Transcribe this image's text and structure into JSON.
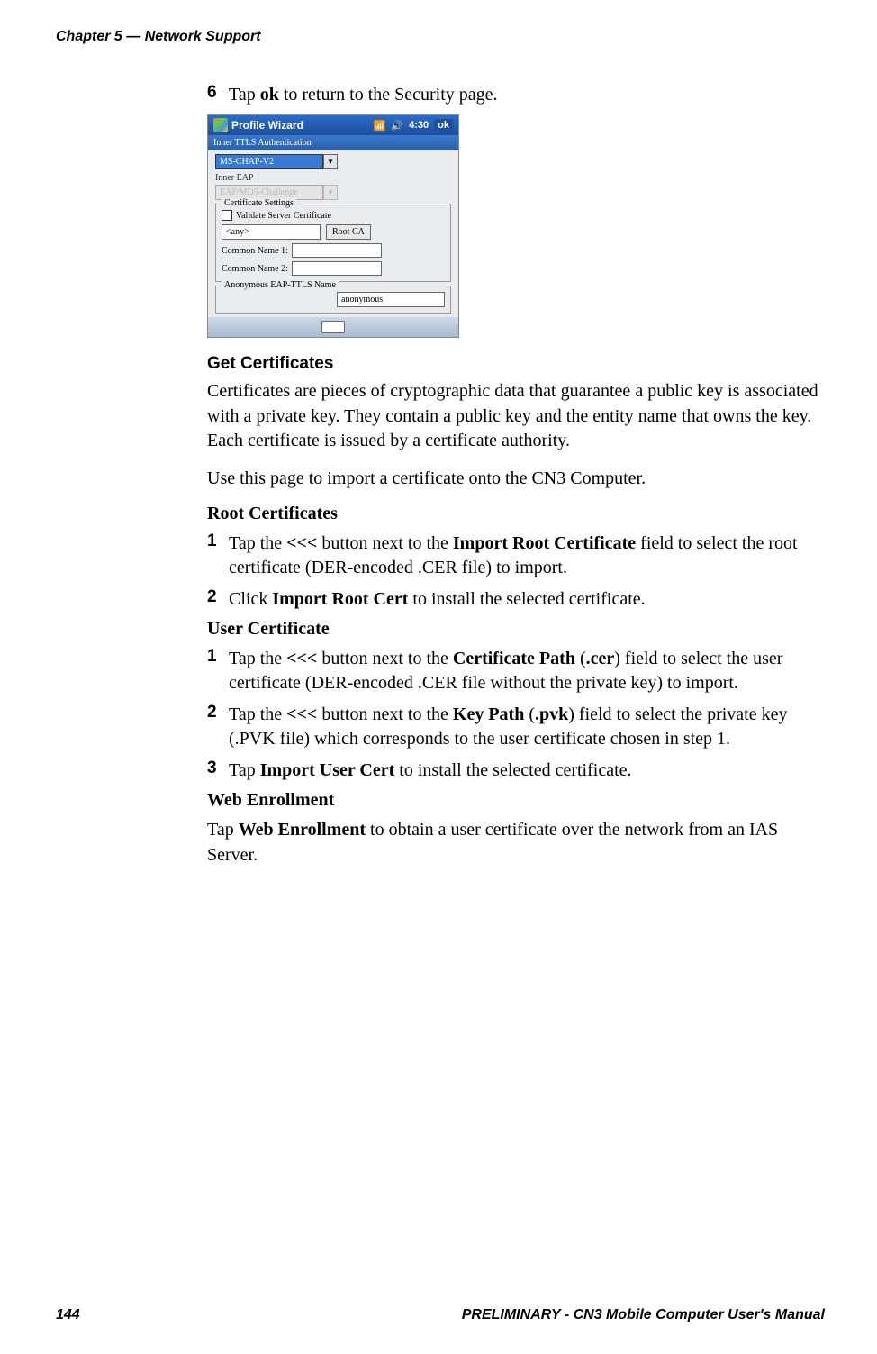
{
  "header": "Chapter 5 — Network Support",
  "step6": {
    "num": "6",
    "text_a": "Tap ",
    "text_b": "ok",
    "text_c": " to return to the Security page."
  },
  "screenshot": {
    "title": "Profile Wizard",
    "time": "4:30",
    "ok": "ok",
    "inner_ttls": "Inner TTLS Authentication",
    "ms_chap": "MS-CHAP-V2",
    "inner_eap": "Inner EAP",
    "eap_md5": "EAP/MD5-Challenge",
    "cert_settings": "Certificate Settings",
    "validate": "Validate Server Certificate",
    "any": "<any>",
    "root_ca": "Root CA",
    "cn1": "Common Name 1:",
    "cn2": "Common Name 2:",
    "anon_legend": "Anonymous EAP-TTLS Name",
    "anon_val": "anonymous"
  },
  "get_cert_head": "Get Certificates",
  "para1": "Certificates are pieces of cryptographic data that guarantee a public key is associated with a private key. They contain a public key and the entity name that owns the key. Each certificate is issued by a certificate authority.",
  "para2": "Use this page to import a certificate onto the CN3 Computer.",
  "root_cert_head": "Root Certificates",
  "rc1": {
    "num": "1",
    "a": "Tap the ",
    "b": "<<<",
    "c": " button next to the ",
    "d": "Import Root Certificate",
    "e": " field to select the root certificate (DER-encoded .CER file) to import."
  },
  "rc2": {
    "num": "2",
    "a": "Click ",
    "b": "Import Root Cert",
    "c": " to install the selected certificate."
  },
  "user_cert_head": "User Certificate",
  "uc1": {
    "num": "1",
    "a": "Tap the ",
    "b": "<<<",
    "c": " button next to the ",
    "d": "Certificate Path",
    "e": " (",
    "f": ".cer",
    "g": ") field to select the user certificate (DER-encoded .CER file without the private key) to import."
  },
  "uc2": {
    "num": "2",
    "a": "Tap the ",
    "b": "<<<",
    "c": " button next to the ",
    "d": "Key Path",
    "e": " (",
    "f": ".pvk",
    "g": ") field to select the private key (.PVK file) which corresponds to the user certificate chosen in step 1."
  },
  "uc3": {
    "num": "3",
    "a": "Tap ",
    "b": "Import User Cert",
    "c": " to install the selected certificate."
  },
  "web_head": "Web Enrollment",
  "web_para": {
    "a": "Tap ",
    "b": "Web Enrollment",
    "c": " to obtain a user certificate over the network from an IAS Server."
  },
  "footer": {
    "page": "144",
    "right": "PRELIMINARY - CN3 Mobile Computer User's Manual"
  }
}
